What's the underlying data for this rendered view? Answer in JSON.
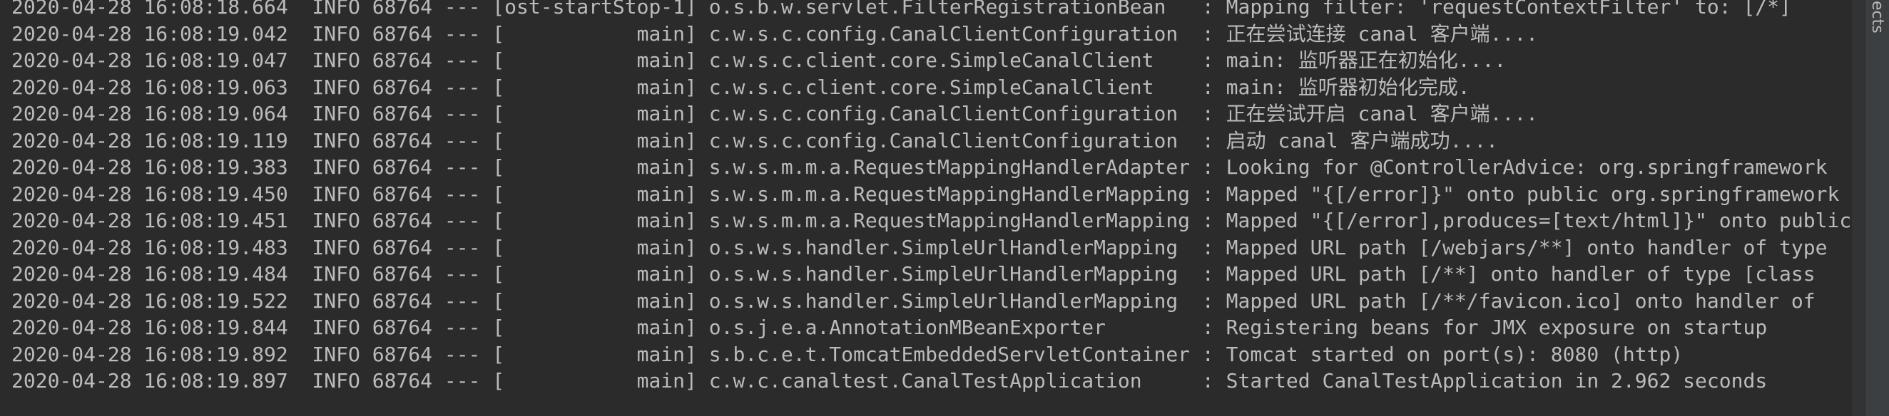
{
  "console": {
    "lines": [
      "2020-04-28 16:08:18.664  INFO 68764 --- [ost-startStop-1] o.s.b.w.servlet.FilterRegistrationBean   : Mapping filter: 'requestContextFilter' to: [/*]",
      "2020-04-28 16:08:19.042  INFO 68764 --- [           main] c.w.s.c.config.CanalClientConfiguration  : 正在尝试连接 canal 客户端....",
      "2020-04-28 16:08:19.047  INFO 68764 --- [           main] c.w.s.c.client.core.SimpleCanalClient    : main: 监听器正在初始化....",
      "2020-04-28 16:08:19.063  INFO 68764 --- [           main] c.w.s.c.client.core.SimpleCanalClient    : main: 监听器初始化完成.",
      "2020-04-28 16:08:19.064  INFO 68764 --- [           main] c.w.s.c.config.CanalClientConfiguration  : 正在尝试开启 canal 客户端....",
      "2020-04-28 16:08:19.119  INFO 68764 --- [           main] c.w.s.c.config.CanalClientConfiguration  : 启动 canal 客户端成功....",
      "2020-04-28 16:08:19.383  INFO 68764 --- [           main] s.w.s.m.m.a.RequestMappingHandlerAdapter : Looking for @ControllerAdvice: org.springframework",
      "2020-04-28 16:08:19.450  INFO 68764 --- [           main] s.w.s.m.m.a.RequestMappingHandlerMapping : Mapped \"{[/error]}\" onto public org.springframework",
      "2020-04-28 16:08:19.451  INFO 68764 --- [           main] s.w.s.m.m.a.RequestMappingHandlerMapping : Mapped \"{[/error],produces=[text/html]}\" onto public",
      "2020-04-28 16:08:19.483  INFO 68764 --- [           main] o.s.w.s.handler.SimpleUrlHandlerMapping  : Mapped URL path [/webjars/**] onto handler of type",
      "2020-04-28 16:08:19.484  INFO 68764 --- [           main] o.s.w.s.handler.SimpleUrlHandlerMapping  : Mapped URL path [/**] onto handler of type [class",
      "2020-04-28 16:08:19.522  INFO 68764 --- [           main] o.s.w.s.handler.SimpleUrlHandlerMapping  : Mapped URL path [/**/favicon.ico] onto handler of",
      "2020-04-28 16:08:19.844  INFO 68764 --- [           main] o.s.j.e.a.AnnotationMBeanExporter        : Registering beans for JMX exposure on startup",
      "2020-04-28 16:08:19.892  INFO 68764 --- [           main] s.b.c.e.t.TomcatEmbeddedServletContainer : Tomcat started on port(s): 8080 (http)",
      "2020-04-28 16:08:19.897  INFO 68764 --- [           main] c.w.c.canaltest.CanalTestApplication     : Started CanalTestApplication in 2.962 seconds"
    ]
  },
  "side_panel": {
    "projects_label": "Projects"
  },
  "colors": {
    "background": "#2b2b2b",
    "text": "#bbbbbb",
    "side_panel": "#3c3f41"
  }
}
